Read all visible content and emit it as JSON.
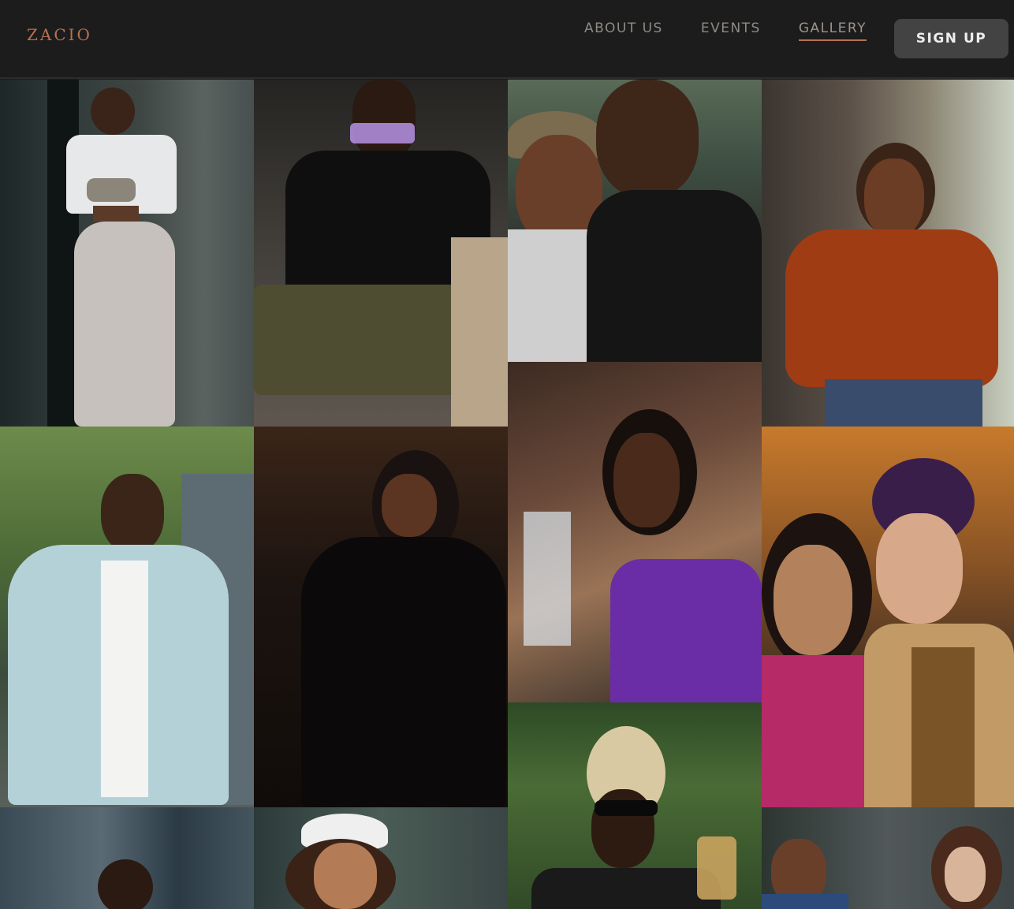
{
  "header": {
    "logo": "ZACIO",
    "nav": [
      {
        "label": "ABOUT US",
        "active": false
      },
      {
        "label": "EVENTS",
        "active": false
      },
      {
        "label": "GALLERY",
        "active": true
      }
    ],
    "signup_label": "SIGN UP"
  },
  "colors": {
    "background": "#1c1c1c",
    "brand_accent": "#b87152",
    "nav_text": "#8f8a84",
    "button_bg": "#434343",
    "button_text": "#ededed"
  }
}
